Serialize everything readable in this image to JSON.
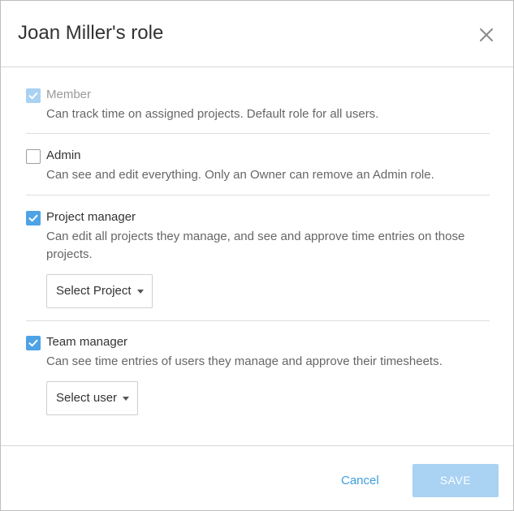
{
  "dialog": {
    "title": "Joan Miller's role"
  },
  "roles": [
    {
      "name": "Member",
      "description": "Can track time on assigned projects. Default role for all users.",
      "checked": true,
      "disabled": true
    },
    {
      "name": "Admin",
      "description": "Can see and edit everything. Only an Owner can remove an Admin role.",
      "checked": false,
      "disabled": false
    },
    {
      "name": "Project manager",
      "description": "Can edit all projects they manage, and see and approve time entries on those projects.",
      "checked": true,
      "disabled": false,
      "select_label": "Select Project"
    },
    {
      "name": "Team manager",
      "description": "Can see time entries of users they manage and approve their timesheets.",
      "checked": true,
      "disabled": false,
      "select_label": "Select user"
    }
  ],
  "footer": {
    "cancel_label": "Cancel",
    "save_label": "SAVE"
  },
  "icons": {
    "close": "close-icon",
    "check": "check-icon",
    "dropdown": "chevron-down-icon"
  },
  "colors": {
    "accent": "#4da3e6",
    "accent_disabled": "#a9d1f2",
    "link": "#3d9ee0"
  }
}
